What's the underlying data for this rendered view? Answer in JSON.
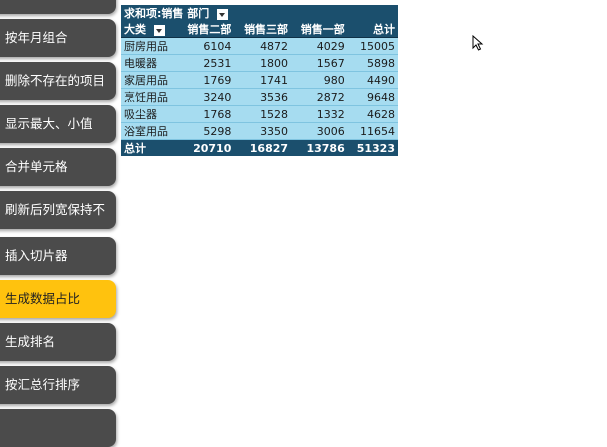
{
  "sidebar": {
    "buttons": [
      {
        "label": ""
      },
      {
        "label": "按年月组合"
      },
      {
        "label": "删除不存在的项目"
      },
      {
        "label": "显示最大、小值"
      },
      {
        "label": "合并单元格"
      },
      {
        "label": "刷新后列宽保持不"
      },
      {
        "label": "插入切片器"
      },
      {
        "label": "生成数据占比"
      },
      {
        "label": "生成排名"
      },
      {
        "label": "按汇总行排序"
      }
    ],
    "active_index": 7
  },
  "pivot": {
    "value_field": "求和项:销售",
    "column_field": "部门",
    "row_field": "大类",
    "columns": [
      "销售二部",
      "销售三部",
      "销售一部",
      "总计"
    ],
    "rows": [
      {
        "label": "厨房用品",
        "values": [
          "6104",
          "4872",
          "4029",
          "15005"
        ]
      },
      {
        "label": "电暖器",
        "values": [
          "2531",
          "1800",
          "1567",
          "5898"
        ]
      },
      {
        "label": "家居用品",
        "values": [
          "1769",
          "1741",
          "980",
          "4490"
        ]
      },
      {
        "label": "烹饪用品",
        "values": [
          "3240",
          "3536",
          "2872",
          "9648"
        ]
      },
      {
        "label": "吸尘器",
        "values": [
          "1768",
          "1528",
          "1332",
          "4628"
        ]
      },
      {
        "label": "浴室用品",
        "values": [
          "5298",
          "3350",
          "3006",
          "11654"
        ]
      }
    ],
    "total": {
      "label": "总计",
      "values": [
        "20710",
        "16827",
        "13786",
        "51323"
      ]
    }
  },
  "colors": {
    "header_bg": "#1b4f6d",
    "row_bg": "#a6dcf0",
    "button_bg": "#4b4b4b",
    "button_active_bg": "#ffc20e"
  }
}
